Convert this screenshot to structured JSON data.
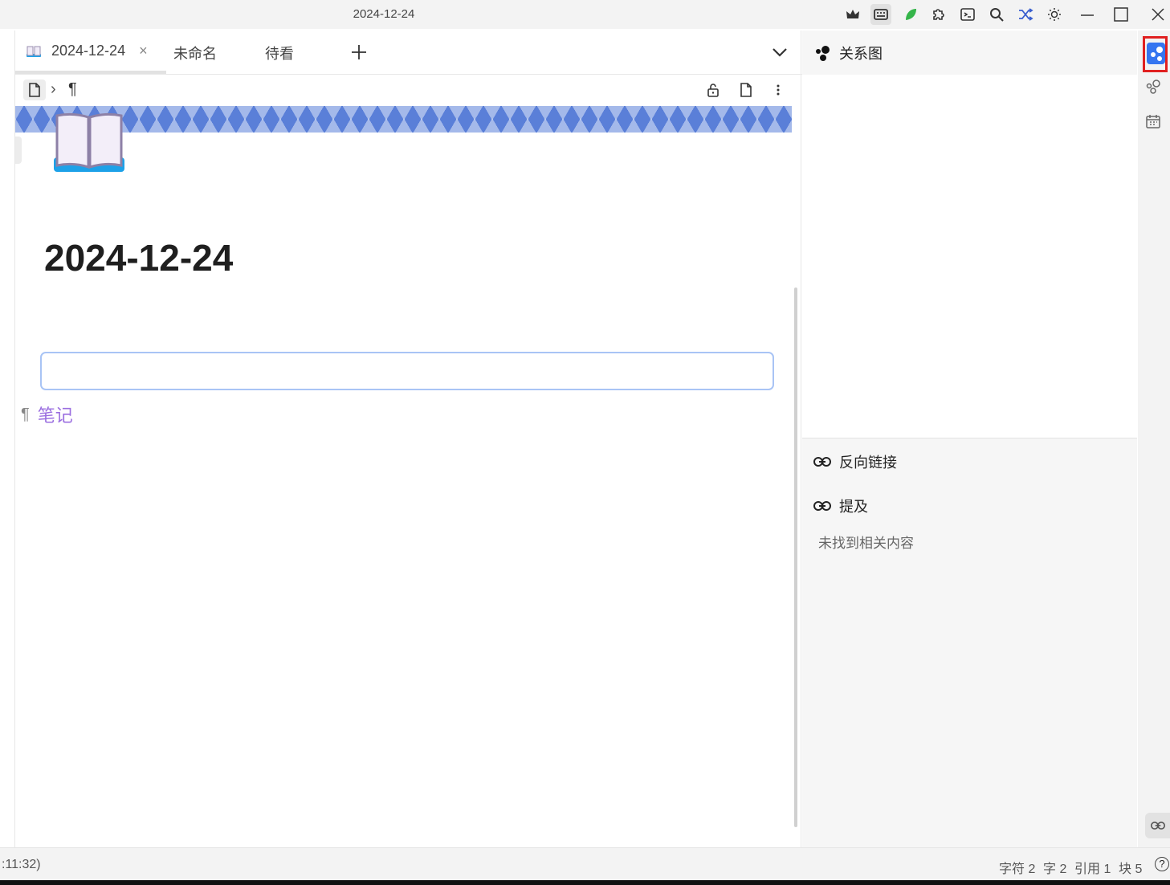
{
  "window": {
    "title": "2024-12-24"
  },
  "tabs": [
    {
      "label": "2024-12-24",
      "icon": "open-book-emoji",
      "active": true
    },
    {
      "label": "未命名"
    },
    {
      "label": "待看"
    }
  ],
  "tab_close": "×",
  "breadcrumb": {
    "separator": "›",
    "paragraph_mark": "¶"
  },
  "document": {
    "title": "2024-12-24",
    "icon": "open-book-emoji",
    "input_value": "",
    "block_ref": {
      "mark": "¶",
      "text": "笔记"
    }
  },
  "right_panel": {
    "graph_title": "关系图",
    "backlinks_title": "反向链接",
    "mentions_title": "提及",
    "empty_text": "未找到相关内容"
  },
  "status": {
    "left": ":11:32)",
    "chars": "字符 2",
    "words": "字 2",
    "refs": "引用 1",
    "blocks": "块 5",
    "help": "?"
  },
  "colors": {
    "accent": "#3575f0",
    "link": "#9b6fe0",
    "input_border": "#a9c4f5",
    "highlight_box": "#e02020"
  }
}
